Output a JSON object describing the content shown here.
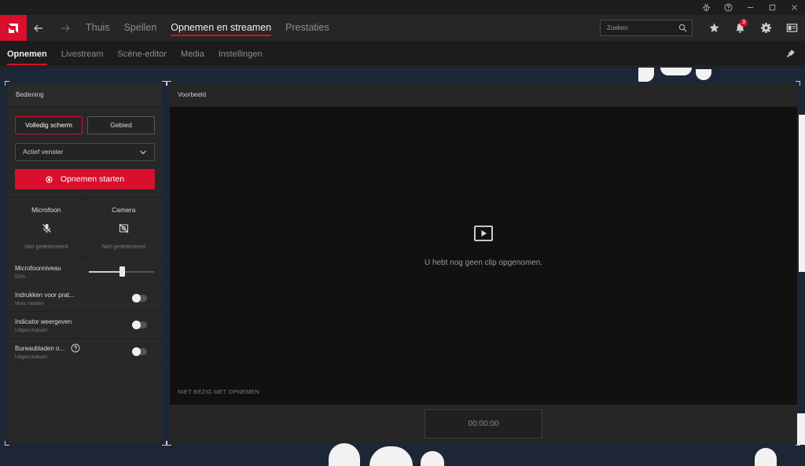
{
  "colors": {
    "accent": "#d80f2d",
    "background": "#1a1a1a",
    "panel": "#282828"
  },
  "titlebar": {
    "icons": [
      "bug-icon",
      "help-icon",
      "minimize-icon",
      "maximize-icon",
      "close-icon"
    ]
  },
  "topnav": {
    "tabs": [
      {
        "label": "Thuis",
        "active": false
      },
      {
        "label": "Spellen",
        "active": false
      },
      {
        "label": "Opnemen en streamen",
        "active": true
      },
      {
        "label": "Prestaties",
        "active": false
      }
    ],
    "search_placeholder": "Zoeken",
    "notification_count": "3"
  },
  "subnav": {
    "tabs": [
      {
        "label": "Opnemen",
        "active": true
      },
      {
        "label": "Livestream",
        "active": false
      },
      {
        "label": "Scène-editor",
        "active": false
      },
      {
        "label": "Media",
        "active": false
      },
      {
        "label": "Instellingen",
        "active": false
      }
    ]
  },
  "controls": {
    "title": "Bediening",
    "mode_fullscreen": "Volledig scherm",
    "mode_region": "Gebied",
    "window_select": "Actief venster",
    "record_button": "Opnemen starten",
    "microphone": {
      "label": "Microfoon",
      "status": "Niet gedetecteerd"
    },
    "camera": {
      "label": "Camera",
      "status": "Niet gedetecteerd"
    },
    "mic_level": {
      "label": "Microfoonniveau",
      "value_text": "50%",
      "value": 50
    },
    "push_to_talk": {
      "label": "Indrukken voor prat...",
      "sub": "Muis midden"
    },
    "show_indicator": {
      "label": "Indicator weergeven",
      "sub": "Uitgeschakeld"
    },
    "desktop_audio": {
      "label": "Bureaubladen o...",
      "sub": "Uitgeschakeld"
    }
  },
  "preview": {
    "title": "Voorbeeld",
    "empty_text": "U hebt nog geen clip opgenomen.",
    "status": "NIET BEZIG MET OPNEMEN",
    "timer": "00:00:00"
  }
}
